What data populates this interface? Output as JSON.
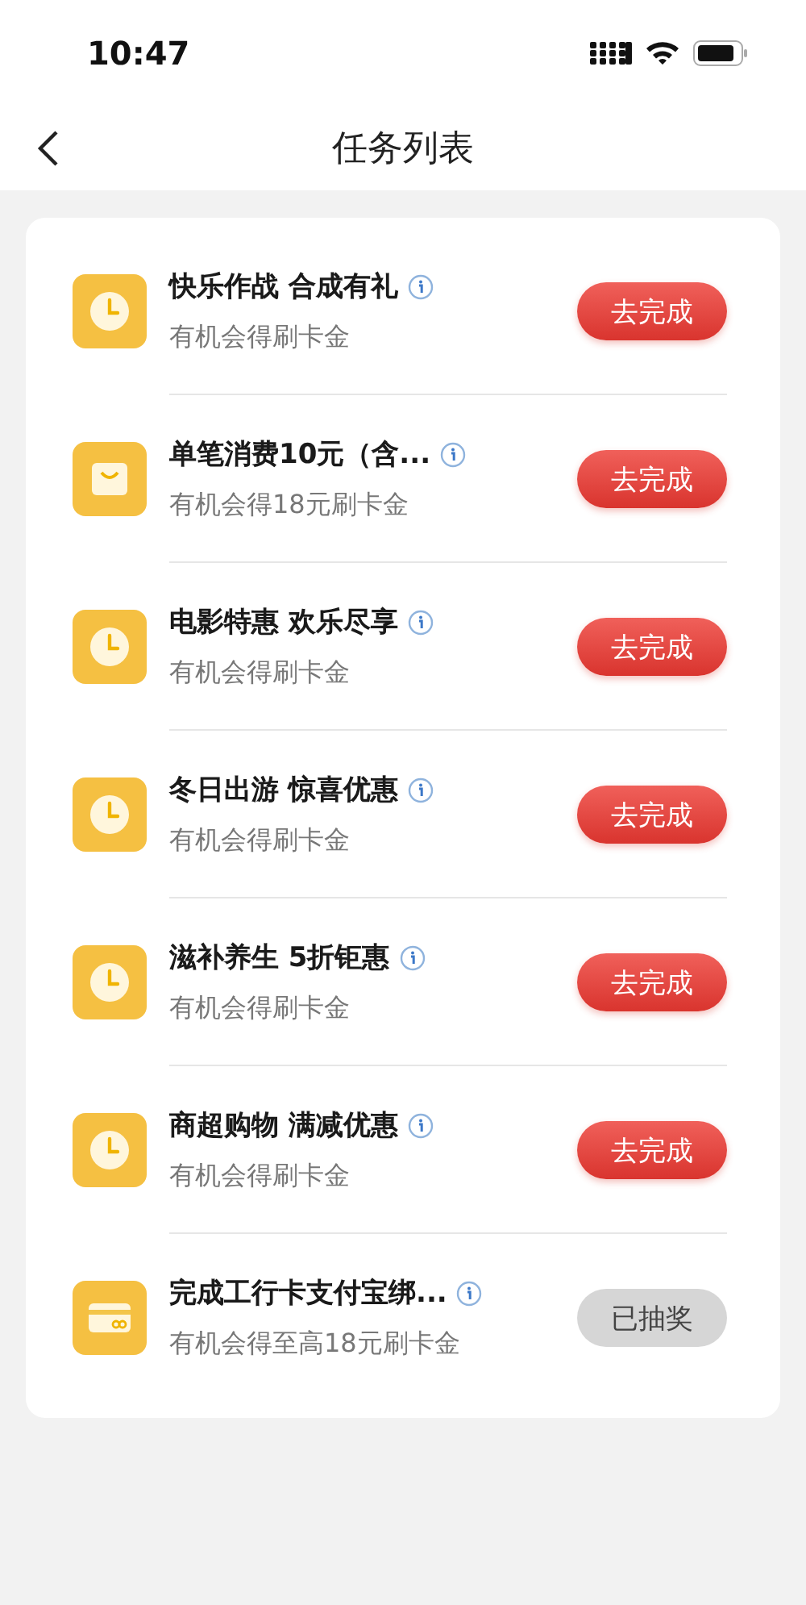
{
  "status_bar": {
    "time": "10:47"
  },
  "nav": {
    "title": "任务列表"
  },
  "tasks": [
    {
      "kind": "clock",
      "title": "快乐作战 合成有礼",
      "subtitle": "有机会得刷卡金",
      "action": "去完成",
      "completed": false
    },
    {
      "kind": "bag",
      "title": "单笔消费10元（含...",
      "subtitle": "有机会得18元刷卡金",
      "action": "去完成",
      "completed": false
    },
    {
      "kind": "clock",
      "title": "电影特惠 欢乐尽享",
      "subtitle": "有机会得刷卡金",
      "action": "去完成",
      "completed": false
    },
    {
      "kind": "clock",
      "title": "冬日出游 惊喜优惠",
      "subtitle": "有机会得刷卡金",
      "action": "去完成",
      "completed": false
    },
    {
      "kind": "clock",
      "title": "滋补养生 5折钜惠",
      "subtitle": "有机会得刷卡金",
      "action": "去完成",
      "completed": false
    },
    {
      "kind": "clock",
      "title": "商超购物 满减优惠",
      "subtitle": "有机会得刷卡金",
      "action": "去完成",
      "completed": false
    },
    {
      "kind": "card",
      "title": "完成工行卡支付宝绑...",
      "subtitle": "有机会得至高18元刷卡金",
      "action": "已抽奖",
      "completed": true
    }
  ]
}
